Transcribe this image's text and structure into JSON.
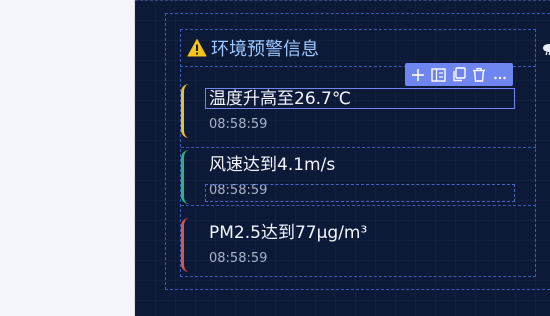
{
  "panel": {
    "title": "环境预警信息"
  },
  "toolbar": {
    "buttons": [
      {
        "name": "add",
        "icon": "plus-icon"
      },
      {
        "name": "layout",
        "icon": "layout-icon"
      },
      {
        "name": "copy",
        "icon": "copy-icon"
      },
      {
        "name": "delete",
        "icon": "trash-icon"
      },
      {
        "name": "more",
        "icon": "more-icon"
      }
    ]
  },
  "alerts": [
    {
      "text": "温度升高至26.7℃",
      "time": "08:58:59",
      "color": "#e7c02a"
    },
    {
      "text": "风速达到4.1m/s",
      "time": "08:58:59",
      "color": "#2fb37a"
    },
    {
      "text": "PM2.5达到77μg/m³",
      "time": "08:58:59",
      "color": "#d9534f"
    }
  ],
  "colors": {
    "background": "#0c1a38",
    "title": "#9cc8ff",
    "toolbar": "#6f86f0",
    "warning": "#f5c518"
  }
}
